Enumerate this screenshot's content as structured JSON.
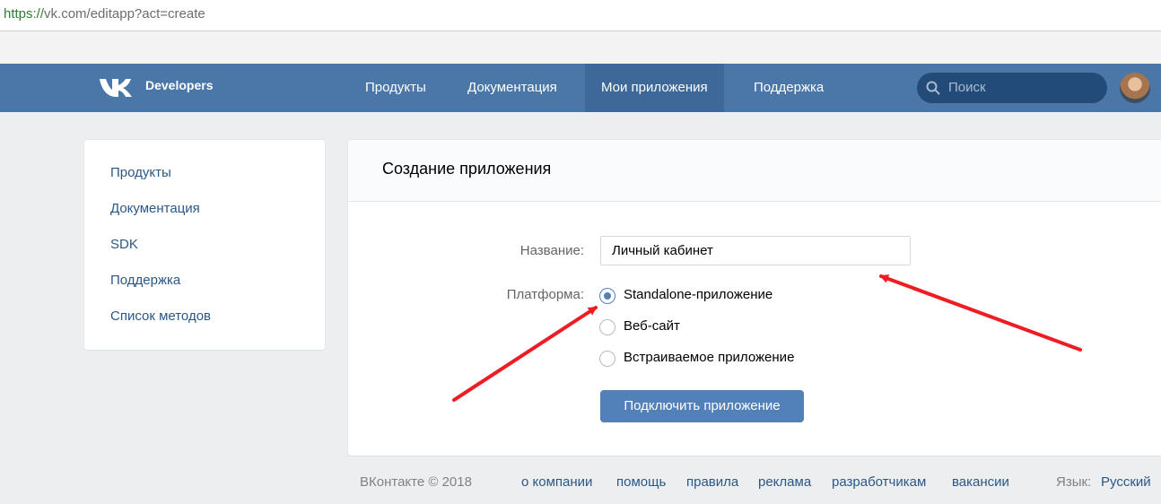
{
  "browser": {
    "url_scheme": "https://",
    "url_rest": "vk.com/editapp?act=create"
  },
  "header": {
    "brand": "Developers",
    "nav": [
      "Продукты",
      "Документация",
      "Мои приложения",
      "Поддержка"
    ],
    "active_nav": "Мои приложения",
    "search_placeholder": "Поиск",
    "accent_color": "#4a76a8"
  },
  "sidebar": {
    "items": [
      "Продукты",
      "Документация",
      "SDK",
      "Поддержка",
      "Список методов"
    ]
  },
  "form": {
    "title": "Создание приложения",
    "name_label": "Название:",
    "name_value": "Личный кабинет",
    "platform_label": "Платформа:",
    "platforms": [
      "Standalone-приложение",
      "Веб-сайт",
      "Встраиваемое приложение"
    ],
    "selected_platform": "Standalone-приложение",
    "submit": "Подключить приложение",
    "button_color": "#5181b8"
  },
  "footer": {
    "copyright": "ВКонтакте © 2018",
    "links": [
      "о компании",
      "помощь",
      "правила",
      "реклама",
      "разработчикам",
      "вакансии"
    ],
    "language_label": "Язык:",
    "language_value": "Русский"
  },
  "annotation_color": "#ee1d23"
}
